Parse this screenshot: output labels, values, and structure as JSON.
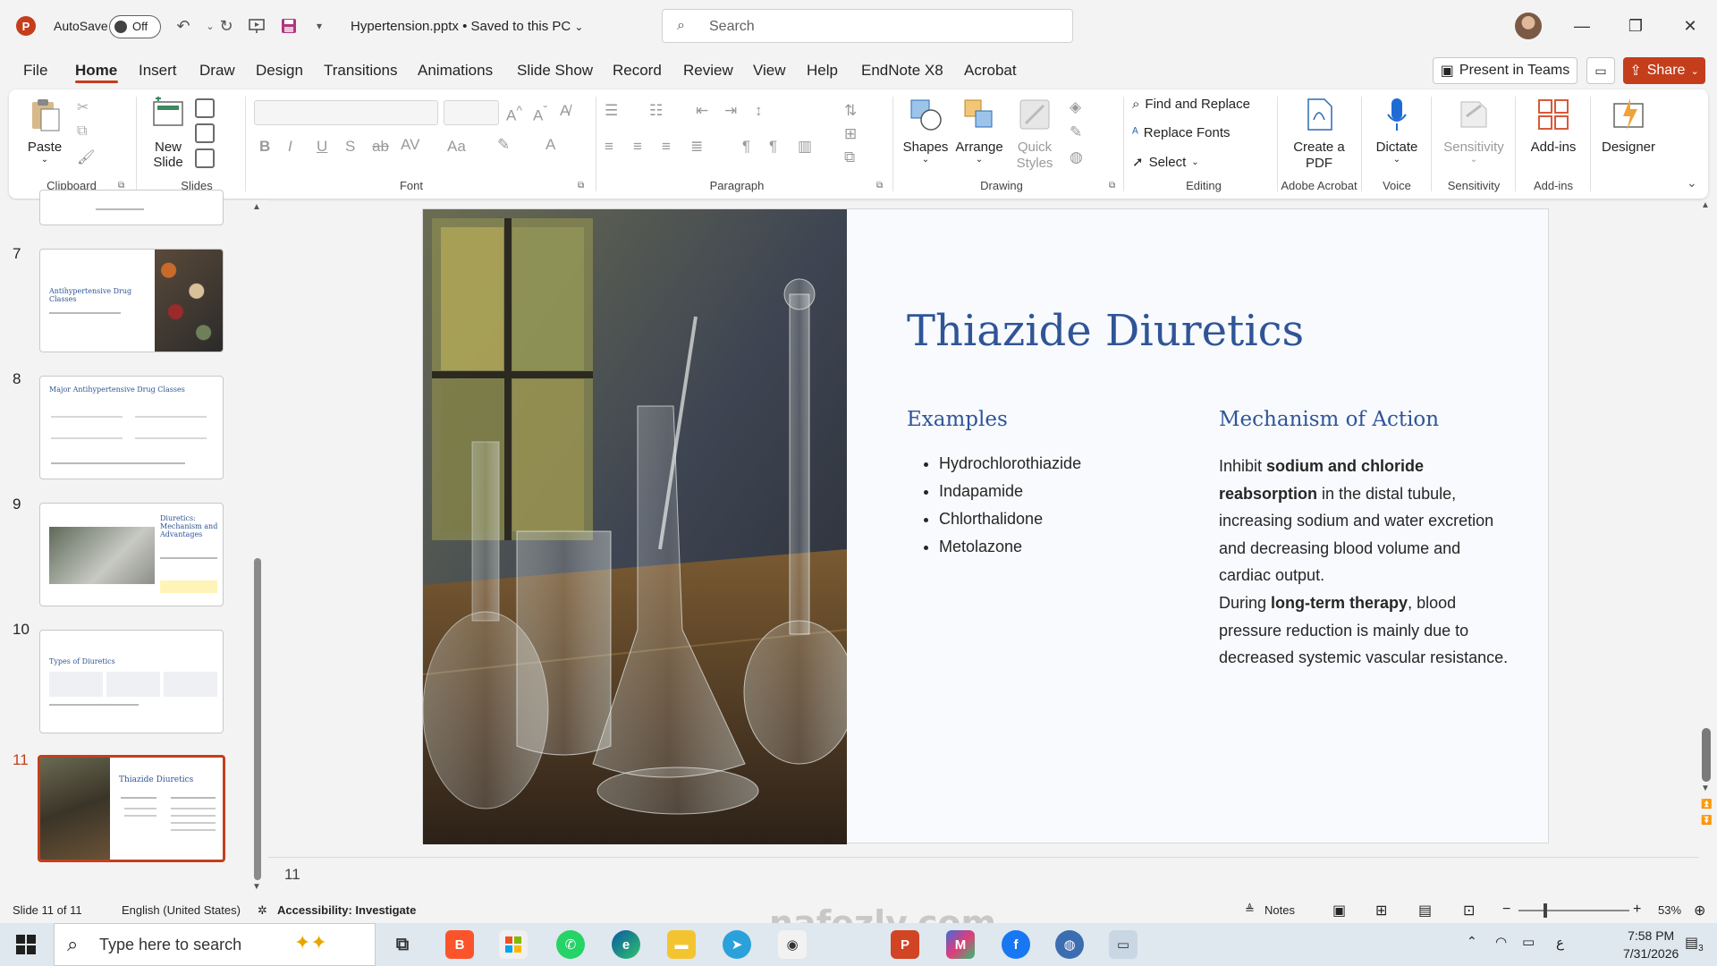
{
  "titlebar": {
    "app_icon": "P",
    "autosave_label": "AutoSave",
    "autosave_state": "Off",
    "doc_title": "Hypertension.pptx • Saved to this PC",
    "search_placeholder": "Search"
  },
  "menu": {
    "tabs": [
      "File",
      "Home",
      "Insert",
      "Draw",
      "Design",
      "Transitions",
      "Animations",
      "Slide Show",
      "Record",
      "Review",
      "View",
      "Help",
      "EndNote X8",
      "Acrobat"
    ],
    "active_tab": "Home",
    "present_teams": "Present in Teams",
    "share": "Share"
  },
  "ribbon": {
    "clipboard": {
      "paste": "Paste",
      "label": "Clipboard"
    },
    "slides": {
      "new_slide": "New Slide",
      "label": "Slides"
    },
    "font": {
      "label": "Font"
    },
    "paragraph": {
      "label": "Paragraph"
    },
    "drawing": {
      "shapes": "Shapes",
      "arrange": "Arrange",
      "quick_styles": "Quick Styles",
      "label": "Drawing"
    },
    "editing": {
      "find_replace": "Find and Replace",
      "replace_fonts": "Replace Fonts",
      "select": "Select",
      "label": "Editing"
    },
    "acrobat": {
      "create_pdf": "Create a PDF",
      "label": "Adobe Acrobat"
    },
    "voice": {
      "dictate": "Dictate",
      "label": "Voice"
    },
    "sensitivity": {
      "btn": "Sensitivity",
      "label": "Sensitivity"
    },
    "addins": {
      "btn": "Add-ins",
      "label": "Add-ins"
    },
    "designer": {
      "btn": "Designer"
    }
  },
  "thumbnails": [
    {
      "num": "7",
      "title": "Antihypertensive Drug Classes"
    },
    {
      "num": "8",
      "title": "Major Antihypertensive Drug Classes"
    },
    {
      "num": "9",
      "title": "Diuretics: Mechanism and Advantages"
    },
    {
      "num": "10",
      "title": "Types of Diuretics"
    },
    {
      "num": "11",
      "title": "Thiazide Diuretics"
    }
  ],
  "slide": {
    "title": "Thiazide Diuretics",
    "examples_heading": "Examples",
    "examples": [
      "Hydrochlorothiazide",
      "Indapamide",
      "Chlorthalidone",
      "Metolazone"
    ],
    "mechanism_heading": "Mechanism of Action",
    "mech_p1_pre": "Inhibit ",
    "mech_p1_bold": "sodium and chloride reabsorption",
    "mech_p1_post": " in the distal tubule, increasing sodium and water excretion and decreasing blood volume and cardiac output.",
    "mech_p2_pre": "During ",
    "mech_p2_bold": "long-term therapy",
    "mech_p2_post": ", blood pressure reduction is mainly due to decreased systemic vascular resistance.",
    "number_below": "11"
  },
  "status": {
    "slide_of": "Slide 11 of 11",
    "language": "English (United States)",
    "accessibility": "Accessibility: Investigate",
    "notes": "Notes",
    "zoom": "53%"
  },
  "taskbar": {
    "search_placeholder": "Type here to search",
    "time": "7:58 PM",
    "date": "7/31/2026",
    "lang": "ع",
    "notif_count": "3"
  },
  "watermark": "nafezly.com"
}
